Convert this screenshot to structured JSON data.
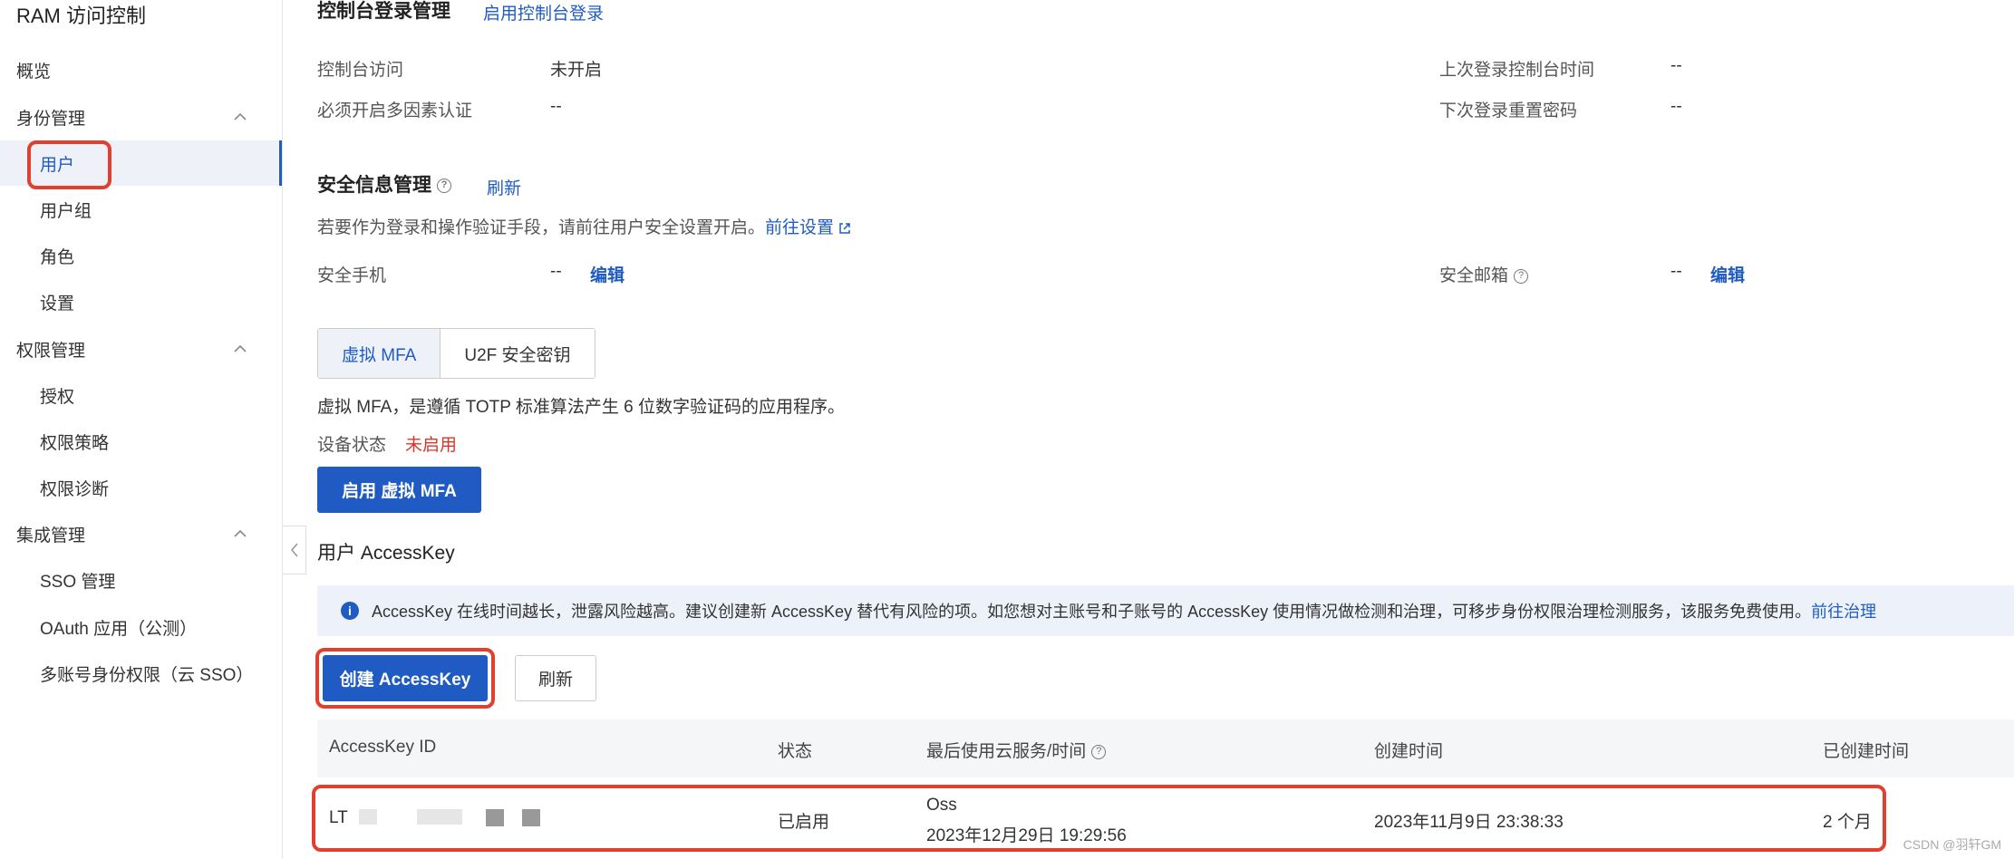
{
  "sidebar": {
    "app_title": "RAM 访问控制",
    "overview": "概览",
    "groups": {
      "identity": "身份管理",
      "permissions": "权限管理",
      "integration": "集成管理"
    },
    "items": {
      "users": "用户",
      "user_groups": "用户组",
      "roles": "角色",
      "settings": "设置",
      "grants": "授权",
      "policies": "权限策略",
      "diagnostics": "权限诊断",
      "sso": "SSO 管理",
      "oauth": "OAuth 应用（公测）",
      "multi_account": "多账号身份权限（云 SSO）"
    }
  },
  "console_login": {
    "title": "控制台登录管理",
    "enable_link": "启用控制台登录",
    "console_access_label": "控制台访问",
    "console_access_value": "未开启",
    "mfa_required_label": "必须开启多因素认证",
    "mfa_required_value": "--",
    "last_login_label": "上次登录控制台时间",
    "last_login_value": "--",
    "reset_pwd_label": "下次登录重置密码",
    "reset_pwd_value": "--"
  },
  "security_info": {
    "title": "安全信息管理",
    "refresh_link": "刷新",
    "hint": "若要作为登录和操作验证手段，请前往用户安全设置开启。",
    "goto_settings": "前往设置",
    "phone_label": "安全手机",
    "phone_value": "--",
    "phone_edit": "编辑",
    "email_label": "安全邮箱",
    "email_value": "--",
    "email_edit": "编辑"
  },
  "mfa": {
    "tabs": [
      "虚拟 MFA",
      "U2F 安全密钥"
    ],
    "description": "虚拟 MFA，是遵循 TOTP 标准算法产生 6 位数字验证码的应用程序。",
    "status_label": "设备状态",
    "status_value": "未启用",
    "enable_button": "启用 虚拟 MFA"
  },
  "accesskey": {
    "title": "用户 AccessKey",
    "notice": "AccessKey 在线时间越长，泄露风险越高。建议创建新 AccessKey 替代有风险的项。如您想对主账号和子账号的 AccessKey 使用情况做检测和治理，可移步身份权限治理检测服务，该服务免费使用。",
    "notice_link": "前往治理",
    "create_button": "创建 AccessKey",
    "refresh_button": "刷新",
    "columns": [
      "AccessKey ID",
      "状态",
      "最后使用云服务/时间",
      "创建时间",
      "已创建时间"
    ],
    "row": {
      "id_prefix": "LT",
      "status": "已启用",
      "last_service": "Oss",
      "last_time": "2023年12月29日 19:29:56",
      "created": "2023年11月9日 23:38:33",
      "age": "2 个月"
    }
  },
  "watermark": "CSDN @羽轩GM",
  "colors": {
    "accent": "#1f5bc2",
    "danger": "#e0402e",
    "status_disabled": "#d9362b"
  }
}
